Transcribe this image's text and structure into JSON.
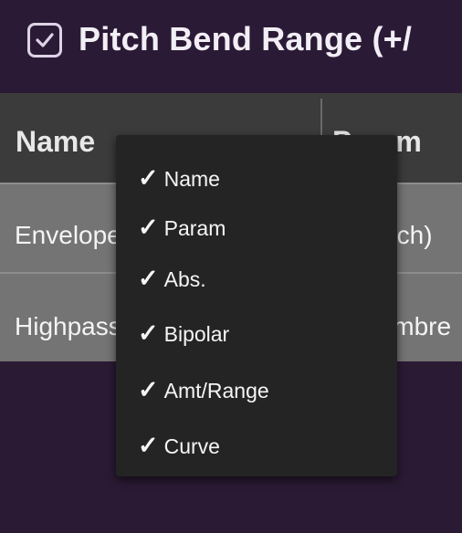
{
  "header": {
    "title": "Pitch Bend Range (+/",
    "enabled_checkbox": "checked"
  },
  "table": {
    "columns": [
      "Name",
      "Param"
    ],
    "rows": [
      {
        "name": "Envelope",
        "param": "Pitch)"
      },
      {
        "name": "Highpass",
        "param": "Timbre"
      }
    ]
  },
  "context_menu": {
    "items": [
      {
        "label": "Name",
        "check": "✓"
      },
      {
        "label": "Param",
        "check": "✓"
      },
      {
        "label": "Abs.",
        "check": "✓"
      },
      {
        "label": "Bipolar",
        "check": "✓"
      },
      {
        "label": "Amt/Range",
        "check": "✓"
      },
      {
        "label": "Curve",
        "check": "✓"
      }
    ]
  },
  "colors": {
    "title_bg": "#2b1a36",
    "header_bg": "#3b3b3b",
    "row_bg": "#747474",
    "menu_bg": "#242424"
  }
}
